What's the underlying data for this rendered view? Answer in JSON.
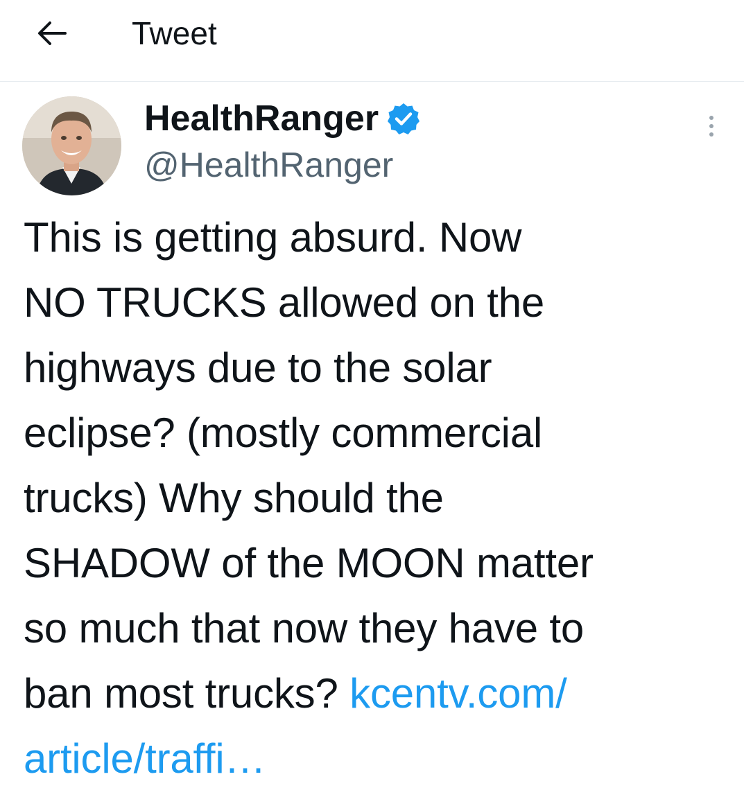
{
  "header": {
    "back_icon": "arrow-left-icon",
    "title": "Tweet"
  },
  "author": {
    "display_name": "HealthRanger",
    "handle": "@HealthRanger",
    "verified_icon": "verified-badge-icon",
    "verified_color": "#1d9bf0"
  },
  "menu": {
    "more_icon": "more-vertical-icon"
  },
  "tweet": {
    "lines": [
      "This is getting absurd. Now",
      "NO TRUCKS allowed on the",
      "highways due to the solar",
      "eclipse? (mostly commercial",
      "trucks) Why should the",
      "SHADOW of the MOON matter",
      "so much that now they have to",
      "ban most trucks? "
    ],
    "link_part1": "kcentv.com/",
    "link_part2": "article/traffi…",
    "link_color": "#1d9bf0"
  }
}
